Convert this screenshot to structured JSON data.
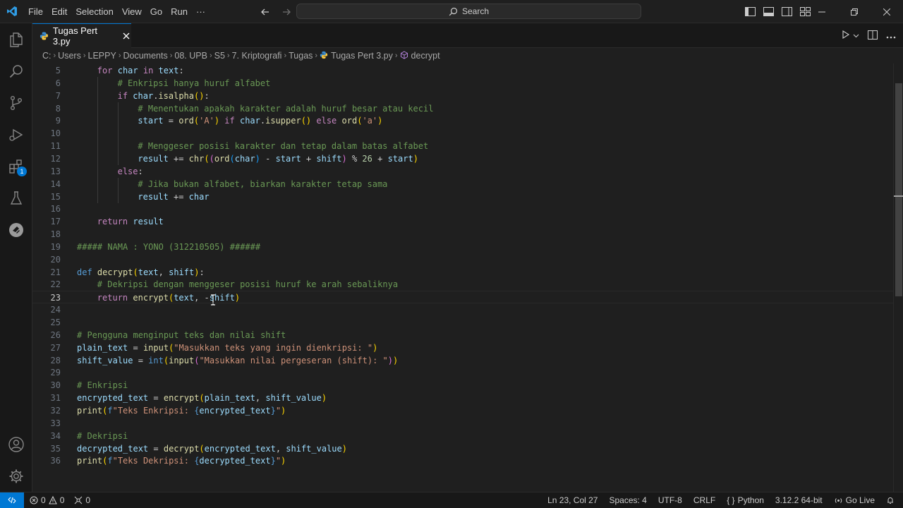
{
  "menu": [
    "File",
    "Edit",
    "Selection",
    "View",
    "Go",
    "Run",
    "···"
  ],
  "search": {
    "label": "Search"
  },
  "tab": {
    "title": "Tugas Pert 3.py"
  },
  "breadcrumb": [
    "C:",
    "Users",
    "LEPPY",
    "Documents",
    "08. UPB",
    "S5",
    "7. Kriptografi",
    "Tugas",
    "Tugas Pert 3.py",
    "decrypt"
  ],
  "activity": {
    "extensions_badge": "1"
  },
  "code": {
    "lines": [
      {
        "n": "5",
        "indent": 1,
        "html": "<span class=\"ctl\">for</span> <span class=\"var\">char</span> <span class=\"ctl\">in</span> <span class=\"var\">text</span>:"
      },
      {
        "n": "6",
        "indent": 2,
        "html": "<span class=\"cm\"># Enkripsi hanya huruf alfabet</span>"
      },
      {
        "n": "7",
        "indent": 2,
        "html": "<span class=\"ctl\">if</span> <span class=\"var\">char</span>.<span class=\"fn\">isalpha</span><span class=\"br1\">()</span>:"
      },
      {
        "n": "8",
        "indent": 3,
        "html": "<span class=\"cm\"># Menentukan apakah karakter adalah huruf besar atau kecil</span>"
      },
      {
        "n": "9",
        "indent": 3,
        "html": "<span class=\"var\">start</span> = <span class=\"fn\">ord</span><span class=\"br1\">(</span><span class=\"str\">'A'</span><span class=\"br1\">)</span> <span class=\"ctl\">if</span> <span class=\"var\">char</span>.<span class=\"fn\">isupper</span><span class=\"br1\">()</span> <span class=\"ctl\">else</span> <span class=\"fn\">ord</span><span class=\"br1\">(</span><span class=\"str\">'a'</span><span class=\"br1\">)</span>"
      },
      {
        "n": "10",
        "indent": 3,
        "html": ""
      },
      {
        "n": "11",
        "indent": 3,
        "html": "<span class=\"cm\"># Menggeser posisi karakter dan tetap dalam batas alfabet</span>"
      },
      {
        "n": "12",
        "indent": 3,
        "html": "<span class=\"var\">result</span> += <span class=\"fn\">chr</span><span class=\"br1\">(</span><span class=\"br2\">(</span><span class=\"fn\">ord</span><span class=\"br3\">(</span><span class=\"var\">char</span><span class=\"br3\">)</span> - <span class=\"var\">start</span> + <span class=\"var\">shift</span><span class=\"br2\">)</span> % <span class=\"num\">26</span> + <span class=\"var\">start</span><span class=\"br1\">)</span>"
      },
      {
        "n": "13",
        "indent": 2,
        "html": "<span class=\"ctl\">else</span>:"
      },
      {
        "n": "14",
        "indent": 3,
        "html": "<span class=\"cm\"># Jika bukan alfabet, biarkan karakter tetap sama</span>"
      },
      {
        "n": "15",
        "indent": 3,
        "html": "<span class=\"var\">result</span> += <span class=\"var\">char</span>"
      },
      {
        "n": "16",
        "indent": 1,
        "html": ""
      },
      {
        "n": "17",
        "indent": 1,
        "html": "<span class=\"ctl\">return</span> <span class=\"var\">result</span>"
      },
      {
        "n": "18",
        "indent": 0,
        "html": ""
      },
      {
        "n": "19",
        "indent": 0,
        "html": "<span class=\"cm\">##### NAMA : YONO (312210505) ######</span>"
      },
      {
        "n": "20",
        "indent": 0,
        "html": ""
      },
      {
        "n": "21",
        "indent": 0,
        "html": "<span class=\"kw\">def</span> <span class=\"fn\">decrypt</span><span class=\"br1\">(</span><span class=\"var\">text</span>, <span class=\"var\">shift</span><span class=\"br1\">)</span>:"
      },
      {
        "n": "22",
        "indent": 1,
        "html": "<span class=\"cm\"># Dekripsi dengan menggeser posisi huruf ke arah sebaliknya</span>"
      },
      {
        "n": "23",
        "indent": 1,
        "html": "<span class=\"ctl\">return</span> <span class=\"fn\">encrypt</span><span class=\"br1\">(</span><span class=\"var\">text</span>, -<span class=\"var\">shift</span><span class=\"br1\">)</span>"
      },
      {
        "n": "24",
        "indent": 0,
        "html": ""
      },
      {
        "n": "25",
        "indent": 0,
        "html": ""
      },
      {
        "n": "26",
        "indent": 0,
        "html": "<span class=\"cm\"># Pengguna menginput teks dan nilai shift</span>"
      },
      {
        "n": "27",
        "indent": 0,
        "html": "<span class=\"var\">plain_text</span> = <span class=\"fn\">input</span><span class=\"br1\">(</span><span class=\"str\">\"Masukkan teks yang ingin dienkripsi: \"</span><span class=\"br1\">)</span>"
      },
      {
        "n": "28",
        "indent": 0,
        "html": "<span class=\"var\">shift_value</span> = <span class=\"kw\">int</span><span class=\"br1\">(</span><span class=\"fn\">input</span><span class=\"br2\">(</span><span class=\"str\">\"Masukkan nilai pergeseran (shift): \"</span><span class=\"br2\">)</span><span class=\"br1\">)</span>"
      },
      {
        "n": "29",
        "indent": 0,
        "html": ""
      },
      {
        "n": "30",
        "indent": 0,
        "html": "<span class=\"cm\"># Enkripsi</span>"
      },
      {
        "n": "31",
        "indent": 0,
        "html": "<span class=\"var\">encrypted_text</span> = <span class=\"fn\">encrypt</span><span class=\"br1\">(</span><span class=\"var\">plain_text</span>, <span class=\"var\">shift_value</span><span class=\"br1\">)</span>"
      },
      {
        "n": "32",
        "indent": 0,
        "html": "<span class=\"fn\">print</span><span class=\"br1\">(</span><span class=\"kw\">f</span><span class=\"str\">\"Teks Enkripsi: </span><span class=\"kw\">{</span><span class=\"var\">encrypted_text</span><span class=\"kw\">}</span><span class=\"str\">\"</span><span class=\"br1\">)</span>"
      },
      {
        "n": "33",
        "indent": 0,
        "html": ""
      },
      {
        "n": "34",
        "indent": 0,
        "html": "<span class=\"cm\"># Dekripsi</span>"
      },
      {
        "n": "35",
        "indent": 0,
        "html": "<span class=\"var\">decrypted_text</span> = <span class=\"fn\">decrypt</span><span class=\"br1\">(</span><span class=\"var\">encrypted_text</span>, <span class=\"var\">shift_value</span><span class=\"br1\">)</span>"
      },
      {
        "n": "36",
        "indent": 0,
        "html": "<span class=\"fn\">print</span><span class=\"br1\">(</span><span class=\"kw\">f</span><span class=\"str\">\"Teks Dekripsi: </span><span class=\"kw\">{</span><span class=\"var\">decrypted_text</span><span class=\"kw\">}</span><span class=\"str\">\"</span><span class=\"br1\">)</span>"
      }
    ],
    "active_line": "23"
  },
  "status": {
    "errors": "0",
    "warnings": "0",
    "ports": "0",
    "position": "Ln 23, Col 27",
    "spaces": "Spaces: 4",
    "encoding": "UTF-8",
    "eol": "CRLF",
    "language_icon": "{ }",
    "language": "Python",
    "interpreter": "3.12.2 64-bit",
    "golive": "Go Live"
  },
  "colors": {
    "accent": "#0078d4",
    "background": "#1f1f1f"
  }
}
